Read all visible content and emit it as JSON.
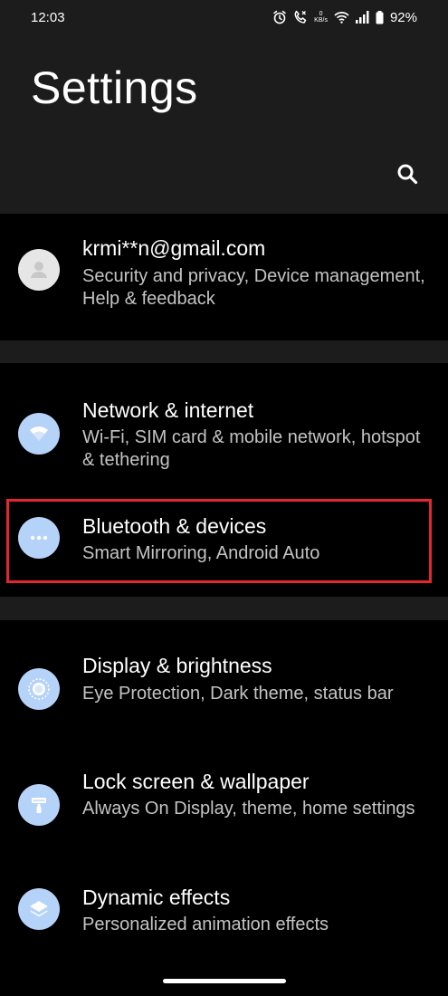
{
  "status_bar": {
    "time": "12:03",
    "speed_value": "0",
    "speed_unit": "KB/s",
    "battery": "92%",
    "icons": [
      "alarm-icon",
      "call-icon",
      "speed-icon",
      "wifi-icon",
      "signal-icon",
      "battery-icon"
    ]
  },
  "header": {
    "title": "Settings",
    "search_icon": "search-icon"
  },
  "account": {
    "email": "krmi**n@gmail.com",
    "subtitle": "Security and privacy, Device management, Help & feedback",
    "icon": "avatar-icon"
  },
  "items": [
    {
      "title": "Network & internet",
      "subtitle": "Wi-Fi, SIM card & mobile network, hotspot & tethering",
      "icon": "wifi-icon"
    },
    {
      "title": "Bluetooth & devices",
      "subtitle": "Smart Mirroring, Android Auto",
      "icon": "more-dots-icon",
      "highlighted": true
    },
    {
      "title": "Display & brightness",
      "subtitle": "Eye Protection, Dark theme, status bar",
      "icon": "brightness-icon"
    },
    {
      "title": "Lock screen & wallpaper",
      "subtitle": "Always On Display, theme, home settings",
      "icon": "paint-roller-icon"
    },
    {
      "title": "Dynamic effects",
      "subtitle": "Personalized animation effects",
      "icon": "layers-icon"
    }
  ],
  "colors": {
    "background": "#000000",
    "header_background": "#1c1c1c",
    "icon_background": "#b5d2f8",
    "highlight_border": "#e3262f"
  }
}
